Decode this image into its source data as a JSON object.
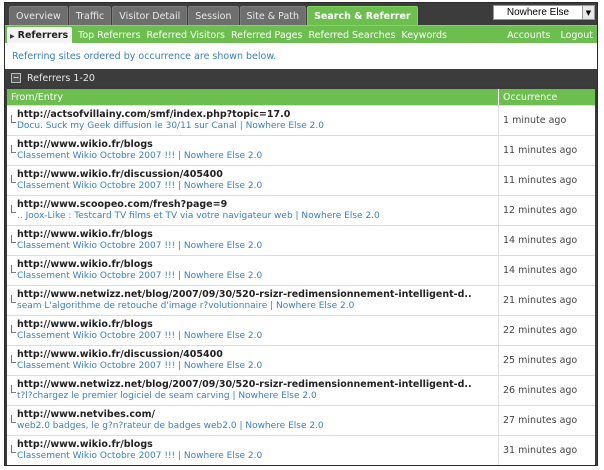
{
  "tabs": [
    {
      "label": "Overview",
      "active": false
    },
    {
      "label": "Traffic",
      "active": false
    },
    {
      "label": "Visitor Detail",
      "active": false
    },
    {
      "label": "Session",
      "active": false
    },
    {
      "label": "Site & Path",
      "active": false
    },
    {
      "label": "Search & Referrer",
      "active": true
    }
  ],
  "site_select": {
    "value": "Nowhere Else"
  },
  "subnav": {
    "items": [
      {
        "label": "Referrers",
        "active": true
      },
      {
        "label": "Top Referrers"
      },
      {
        "label": "Referred Visitors"
      },
      {
        "label": "Referred Pages"
      },
      {
        "label": "Referred Searches"
      },
      {
        "label": "Keywords"
      }
    ],
    "accounts": "Accounts",
    "logout": "Logout"
  },
  "description": "Referring sites ordered by occurrence are shown below.",
  "section": {
    "title": "Referrers 1-20",
    "collapse_symbol": "−"
  },
  "table": {
    "col_from": "From/Entry",
    "col_occurrence": "Occurrence",
    "rows": [
      {
        "url": "http://actsofvillainy.com/smf/index.php?topic=17.0",
        "entry": "Docu. Suck my Geek diffusion le 30/11 sur Canal  |  Nowhere Else 2.0",
        "time": "1 minute ago"
      },
      {
        "url": "http://www.wikio.fr/blogs",
        "entry": "Classement Wikio Octobre 2007 !!!  |  Nowhere Else 2.0",
        "time": "11 minutes ago"
      },
      {
        "url": "http://www.wikio.fr/discussion/405400",
        "entry": "Classement Wikio Octobre 2007 !!!  |  Nowhere Else 2.0",
        "time": "11 minutes ago"
      },
      {
        "url": "http://www.scoopeo.com/fresh?page=9",
        "entry": ".. Joox-Like : Testcard TV films et TV via votre navigateur web  |  Nowhere Else 2.0",
        "time": "12 minutes ago"
      },
      {
        "url": "http://www.wikio.fr/blogs",
        "entry": "Classement Wikio Octobre 2007 !!!  |  Nowhere Else 2.0",
        "time": "14 minutes ago"
      },
      {
        "url": "http://www.wikio.fr/blogs",
        "entry": "Classement Wikio Octobre 2007 !!!  |  Nowhere Else 2.0",
        "time": "14 minutes ago"
      },
      {
        "url": "http://www.netwizz.net/blog/2007/09/30/520-rsizr-redimensionnement-intelligent-d..",
        "entry": "seam L'algorithme de retouche d'image r?volutionnaire  |  Nowhere Else 2.0",
        "time": "21 minutes ago"
      },
      {
        "url": "http://www.wikio.fr/blogs",
        "entry": "Classement Wikio Octobre 2007 !!!  |  Nowhere Else 2.0",
        "time": "22 minutes ago"
      },
      {
        "url": "http://www.wikio.fr/discussion/405400",
        "entry": "Classement Wikio Octobre 2007 !!!  |  Nowhere Else 2.0",
        "time": "25 minutes ago"
      },
      {
        "url": "http://www.netwizz.net/blog/2007/09/30/520-rsizr-redimensionnement-intelligent-d..",
        "entry": "t?l?chargez le premier logiciel de seam carving  |  Nowhere Else 2.0",
        "time": "26 minutes ago"
      },
      {
        "url": "http://www.netvibes.com/",
        "entry": "web2.0 badges, le g?n?rateur de badges web2.0  |  Nowhere Else 2.0",
        "time": "27 minutes ago"
      },
      {
        "url": "http://www.wikio.fr/blogs",
        "entry": "Classement Wikio Octobre 2007 !!!  |  Nowhere Else 2.0",
        "time": "31 minutes ago"
      }
    ]
  }
}
